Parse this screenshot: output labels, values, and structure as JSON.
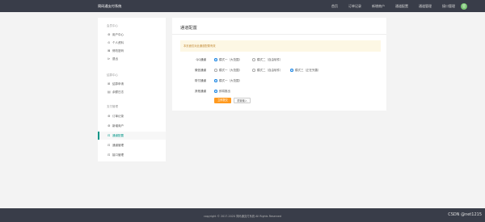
{
  "header": {
    "brand": "简码通支付系统",
    "nav": [
      "首页",
      "订单记录",
      "新增商户",
      "通道配置",
      "通道管理",
      "接口管理"
    ],
    "avatar_initial": "官"
  },
  "sidebar": {
    "groups": [
      {
        "title": "会员中心",
        "items": [
          {
            "icon": "user-circle-icon",
            "glyph": "⊚",
            "label": "用户中心"
          },
          {
            "icon": "profile-icon",
            "glyph": "⊙",
            "label": "个人资料"
          },
          {
            "icon": "lock-icon",
            "glyph": "⊠",
            "label": "修改密码"
          },
          {
            "icon": "logout-icon",
            "glyph": "⊳",
            "label": "退出"
          }
        ]
      },
      {
        "title": "结算中心",
        "items": [
          {
            "icon": "settle-icon",
            "glyph": "⊞",
            "label": "结算申请"
          },
          {
            "icon": "record-icon",
            "glyph": "▤",
            "label": "余额日志"
          }
        ]
      },
      {
        "title": "支付管理",
        "items": [
          {
            "icon": "order-icon",
            "glyph": "⊚",
            "label": "订单记录"
          },
          {
            "icon": "merchant-icon",
            "glyph": "⊚",
            "label": "新增商户"
          },
          {
            "icon": "channel-config-icon",
            "glyph": "⊡",
            "label": "通道配置",
            "active": true
          },
          {
            "icon": "channel-manage-icon",
            "glyph": "⊡",
            "label": "通道管理"
          },
          {
            "icon": "api-icon",
            "glyph": "⊡",
            "label": "接口管理"
          }
        ]
      }
    ]
  },
  "main": {
    "title": "通道配置",
    "notice": "本页面仅对此通道配置有效",
    "rows": [
      {
        "label": "QQ通道",
        "options": [
          {
            "label": "模式一（大范围）",
            "checked": true
          },
          {
            "label": "模式二（自由软件）",
            "checked": false
          }
        ]
      },
      {
        "label": "微信通道",
        "options": [
          {
            "label": "模式一（大范围）",
            "checked": false
          },
          {
            "label": "模式二（自由软件）",
            "checked": false
          },
          {
            "label": "模式三（正在完善）",
            "checked": true
          }
        ]
      },
      {
        "label": "财付通道",
        "options": [
          {
            "label": "模式一（大范围）",
            "checked": true
          }
        ]
      },
      {
        "label": "其他通道",
        "options": [
          {
            "label": "即将推出",
            "checked": true
          }
        ]
      }
    ],
    "submit_label": "立即提交",
    "reset_label": "重置输入"
  },
  "footer": {
    "copyright": "copyright © 2017-2020 简码通支付系统 All Rights Reserved",
    "watermark": "CSDN @net1215"
  },
  "colors": {
    "topbar": "#393d49",
    "accent": "#009688",
    "primary_button": "#ff9a1f",
    "radio_checked": "#1e88e5",
    "notice_bg": "#fdf7e4"
  }
}
